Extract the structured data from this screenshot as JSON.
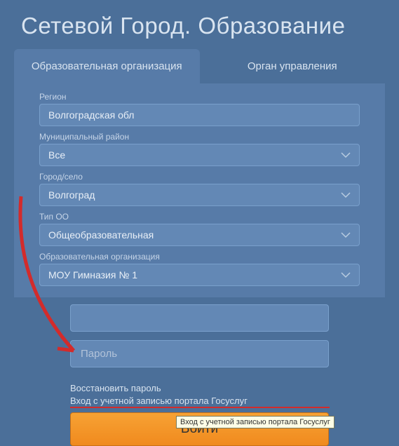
{
  "title": "Сетевой Город. Образование",
  "tabs": {
    "edu_org": "Образовательная организация",
    "management": "Орган управления"
  },
  "form": {
    "region": {
      "label": "Регион",
      "value": "Волгоградская обл"
    },
    "district": {
      "label": "Муниципальный район",
      "value": "Все"
    },
    "city": {
      "label": "Город/село",
      "value": "Волгоград"
    },
    "type": {
      "label": "Тип ОО",
      "value": "Общеобразовательная"
    },
    "org": {
      "label": "Образовательная организация",
      "value": "МОУ Гимназия № 1"
    }
  },
  "login": {
    "username_placeholder": "",
    "password_placeholder": "Пароль",
    "recover": "Восстановить пароль",
    "gosuslugi": "Вход с учетной записью портала Госуслуг",
    "button": "Войти",
    "tooltip": "Вход с учетной записью портала Госуслуг"
  },
  "icons": {
    "chevron_down": "chevron-down-icon"
  },
  "colors": {
    "accent": "#f08a1e",
    "annotation": "#d32b2b"
  }
}
